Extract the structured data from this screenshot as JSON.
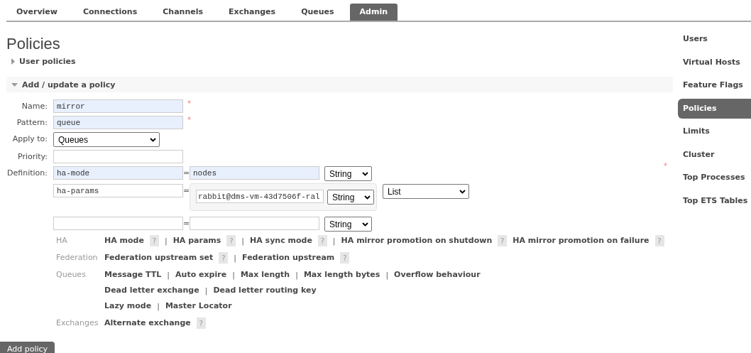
{
  "tabs": [
    {
      "label": "Overview",
      "selected": false
    },
    {
      "label": "Connections",
      "selected": false
    },
    {
      "label": "Channels",
      "selected": false
    },
    {
      "label": "Exchanges",
      "selected": false
    },
    {
      "label": "Queues",
      "selected": false
    },
    {
      "label": "Admin",
      "selected": true
    }
  ],
  "page_title": "Policies",
  "sections": [
    {
      "title": "User policies",
      "expanded": false
    },
    {
      "title": "Add / update a policy",
      "expanded": true
    }
  ],
  "form": {
    "fields": [
      {
        "kind": "text",
        "label": "Name:",
        "value": "mirror",
        "autofilled": true,
        "required_mark": "*"
      },
      {
        "kind": "text",
        "label": "Pattern:",
        "value": "queue",
        "autofilled": true,
        "required_mark": "*"
      },
      {
        "kind": "select",
        "label": "Apply to:",
        "value": "Queues"
      },
      {
        "kind": "text",
        "label": "Priority:",
        "autofilled": false
      }
    ],
    "definition": {
      "label": "Definition:",
      "required_mark": "*",
      "equals": "=",
      "rows": [
        {
          "kind": "string",
          "key": "ha-mode",
          "value": "nodes",
          "type": "String",
          "autofilled": true
        },
        {
          "kind": "list",
          "key": "ha-params",
          "items": [
            {
              "value": "rabbit@dms-vm-43d7506f-ral",
              "type": "String"
            }
          ],
          "type": "List",
          "autofilled": false
        },
        {
          "kind": "string",
          "type": "String",
          "autofilled": false
        }
      ]
    }
  },
  "help_groups": [
    {
      "label": "HA",
      "lines": [
        [
          {
            "text": "HA mode",
            "help": "?",
            "sep": "|"
          },
          {
            "text": "HA params",
            "help": "?",
            "sep": "|"
          },
          {
            "text": "HA sync mode",
            "help": "?",
            "sep": "|"
          },
          {
            "text": "HA mirror promotion on shutdown",
            "help": "?"
          },
          {
            "text": "HA mirror promotion on failure",
            "help": "?"
          }
        ]
      ]
    },
    {
      "label": "Federation",
      "lines": [
        [
          {
            "text": "Federation upstream set",
            "help": "?",
            "sep": "|"
          },
          {
            "text": "Federation upstream",
            "help": "?"
          }
        ]
      ]
    },
    {
      "label": "Queues",
      "lines": [
        [
          {
            "text": "Message TTL",
            "sep": "|"
          },
          {
            "text": "Auto expire",
            "sep": "|"
          },
          {
            "text": "Max length",
            "sep": "|"
          },
          {
            "text": "Max length bytes",
            "sep": "|"
          },
          {
            "text": "Overflow behaviour"
          }
        ],
        [
          {
            "text": "Dead letter exchange",
            "sep": "|"
          },
          {
            "text": "Dead letter routing key"
          }
        ],
        [
          {
            "text": "Lazy mode",
            "sep": "|"
          },
          {
            "text": "Master Locator"
          }
        ]
      ]
    },
    {
      "label": "Exchanges",
      "lines": [
        [
          {
            "text": "Alternate exchange",
            "help": "?"
          }
        ]
      ]
    }
  ],
  "submit": "Add policy",
  "sidebar": [
    {
      "label": "Users",
      "selected": false
    },
    {
      "label": "Virtual Hosts",
      "selected": false
    },
    {
      "label": "Feature Flags",
      "selected": false
    },
    {
      "label": "Policies",
      "selected": true
    },
    {
      "label": "Limits",
      "selected": false
    },
    {
      "label": "Cluster",
      "selected": false
    },
    {
      "label": "Top Processes",
      "selected": false
    },
    {
      "label": "Top ETS Tables",
      "selected": false
    }
  ]
}
